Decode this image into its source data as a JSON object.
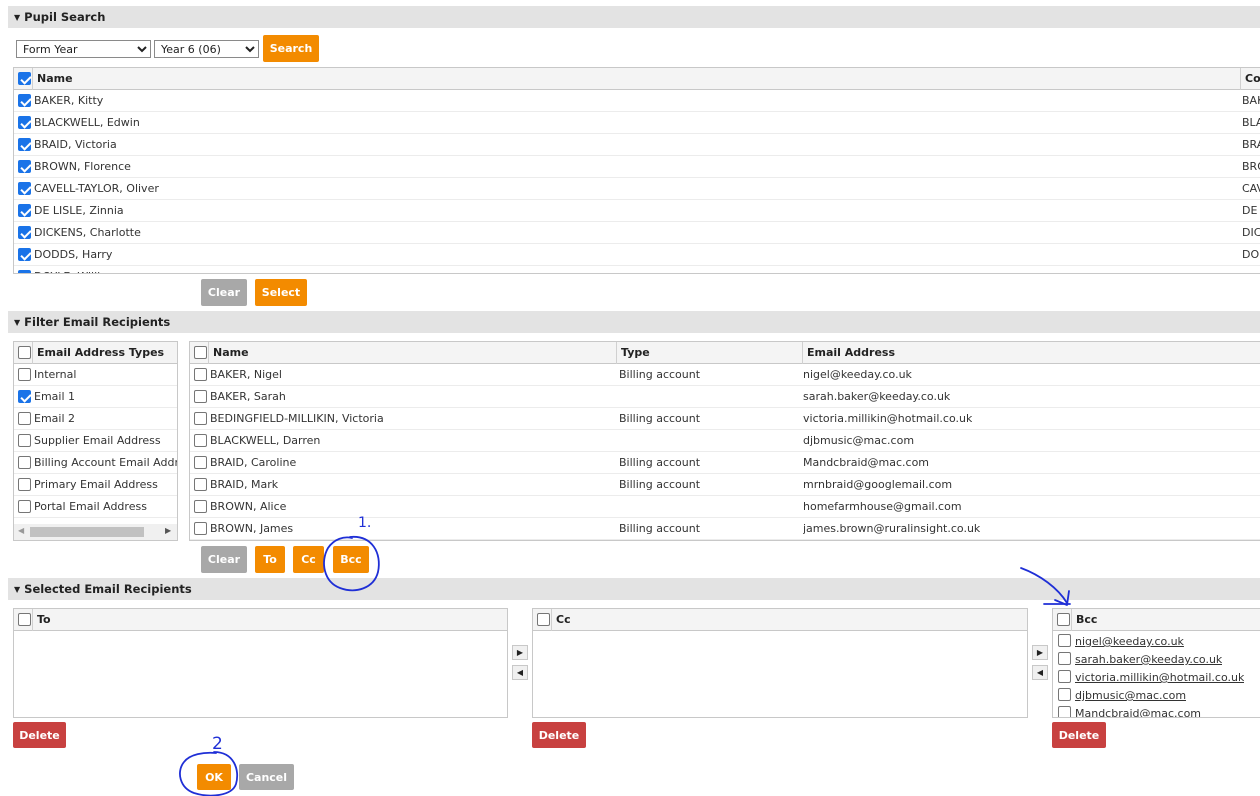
{
  "pupil_search": {
    "header": "Pupil Search",
    "filter_type": "Form Year",
    "filter_value": "Year 6 (06)",
    "search_label": "Search",
    "col_name": "Name",
    "col_code": "Coc",
    "pupils": [
      {
        "name": "BAKER, Kitty",
        "code": "BAK"
      },
      {
        "name": "BLACKWELL, Edwin",
        "code": "BLA"
      },
      {
        "name": "BRAID, Victoria",
        "code": "BRA"
      },
      {
        "name": "BROWN, Florence",
        "code": "BRO"
      },
      {
        "name": "CAVELL-TAYLOR, Oliver",
        "code": "CAV"
      },
      {
        "name": "DE LISLE, Zinnia",
        "code": "DE"
      },
      {
        "name": "DICKENS, Charlotte",
        "code": "DIC"
      },
      {
        "name": "DODDS, Harry",
        "code": "DOD"
      }
    ],
    "clear_label": "Clear",
    "select_label": "Select"
  },
  "filter": {
    "header": "Filter Email Recipients",
    "types_header": "Email Address Types",
    "types": [
      {
        "label": "Internal",
        "checked": false
      },
      {
        "label": "Email 1",
        "checked": true
      },
      {
        "label": "Email 2",
        "checked": false
      },
      {
        "label": "Supplier Email Address",
        "checked": false
      },
      {
        "label": "Billing Account Email Addr",
        "checked": false
      },
      {
        "label": "Primary Email Address",
        "checked": false
      },
      {
        "label": "Portal Email Address",
        "checked": false
      }
    ],
    "col_name": "Name",
    "col_type": "Type",
    "col_email": "Email Address",
    "recipients": [
      {
        "name": "BAKER, Nigel",
        "type": "Billing account",
        "email": "nigel@keeday.co.uk"
      },
      {
        "name": "BAKER, Sarah",
        "type": "",
        "email": "sarah.baker@keeday.co.uk"
      },
      {
        "name": "BEDINGFIELD-MILLIKIN, Victoria",
        "type": "Billing account",
        "email": "victoria.millikin@hotmail.co.uk"
      },
      {
        "name": "BLACKWELL, Darren",
        "type": "",
        "email": "djbmusic@mac.com"
      },
      {
        "name": "BRAID, Caroline",
        "type": "Billing account",
        "email": "Mandcbraid@mac.com"
      },
      {
        "name": "BRAID, Mark",
        "type": "Billing account",
        "email": "mrnbraid@googlemail.com"
      },
      {
        "name": "BROWN, Alice",
        "type": "",
        "email": "homefarmhouse@gmail.com"
      },
      {
        "name": "BROWN, James",
        "type": "Billing account",
        "email": "james.brown@ruralinsight.co.uk"
      }
    ],
    "clear_label": "Clear",
    "to_label": "To",
    "cc_label": "Cc",
    "bcc_label": "Bcc"
  },
  "selected": {
    "header": "Selected Email Recipients",
    "to_header": "To",
    "cc_header": "Cc",
    "bcc_header": "Bcc",
    "bcc_items": [
      "nigel@keeday.co.uk",
      "sarah.baker@keeday.co.uk",
      "victoria.millikin@hotmail.co.uk",
      "djbmusic@mac.com",
      "Mandcbraid@mac.com"
    ],
    "delete_label": "Delete",
    "ok_label": "OK",
    "cancel_label": "Cancel"
  },
  "annotations": {
    "mark_1": "1.",
    "mark_2": "2",
    "color": "#1f2fd6"
  },
  "colors": {
    "accent_orange": "#f38b00",
    "delete_red": "#c84140",
    "checkbox_blue": "#1a73e8"
  }
}
